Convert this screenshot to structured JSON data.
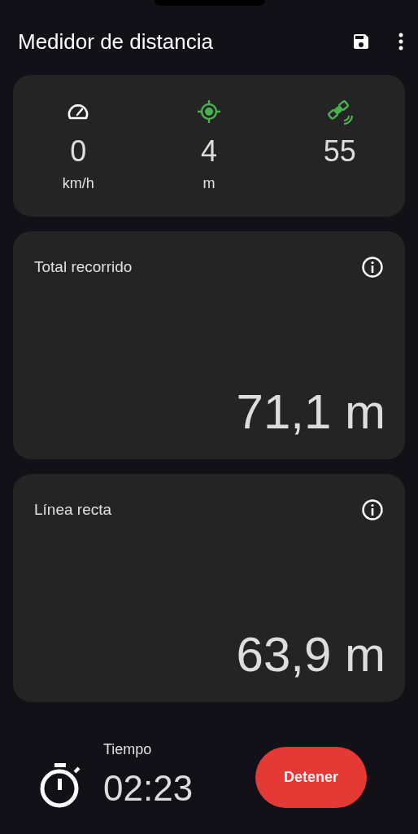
{
  "app_bar": {
    "title": "Medidor de distancia"
  },
  "stats": [
    {
      "kind": "speed",
      "value": "0",
      "unit": "km/h",
      "color": "#ffffff"
    },
    {
      "kind": "accuracy",
      "value": "4",
      "unit": "m",
      "color": "#4caf50"
    },
    {
      "kind": "satellites",
      "value": "55",
      "color": "#4caf50"
    }
  ],
  "cards": [
    {
      "label": "Total recorrido",
      "value": "71,1 m"
    },
    {
      "label": "Línea recta",
      "value": "63,9 m"
    }
  ],
  "timer": {
    "label": "Tiempo",
    "value": "02:23"
  },
  "stop_button": {
    "label": "Detener"
  }
}
